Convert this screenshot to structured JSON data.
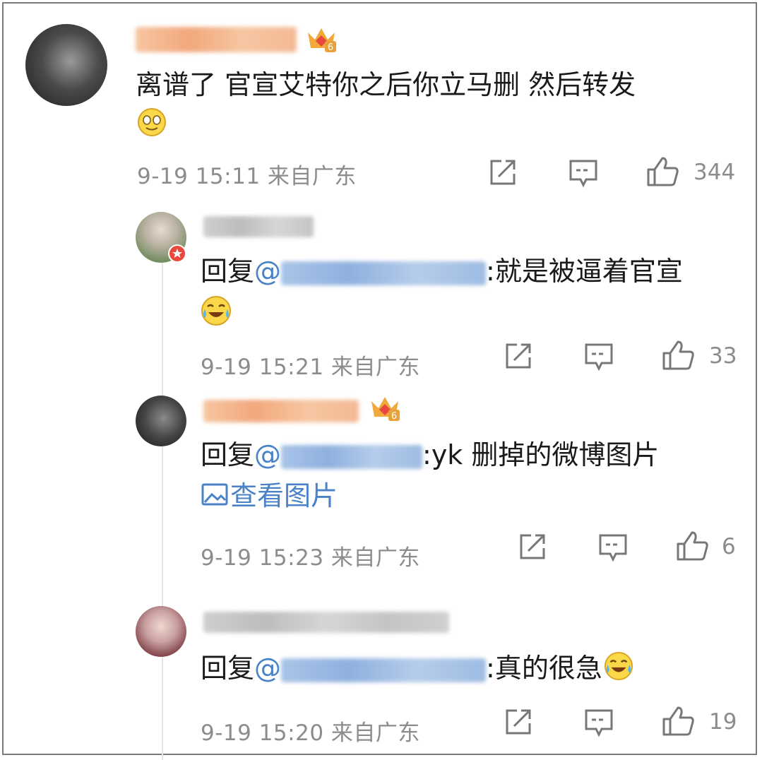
{
  "comments": [
    {
      "text": "离谱了 官宣艾特你之后你立马删 然后转发",
      "time": "9-19 15:11",
      "location": "来自广东",
      "likes": "344",
      "badge_level": "6",
      "emoji_icon": "smile-emoji-icon"
    },
    {
      "reply_prefix": "回复",
      "mention_at": "@",
      "text": ":就是被逼着官宣",
      "time": "9-19 15:21",
      "location": "来自广东",
      "likes": "33",
      "emoji_icon": "laugh-cry-emoji-icon"
    },
    {
      "reply_prefix": "回复",
      "mention_at": "@",
      "text": ":yk 删掉的微博图片",
      "view_image": "查看图片",
      "time": "9-19 15:23",
      "location": "来自广东",
      "likes": "6",
      "badge_level": "6"
    },
    {
      "reply_prefix": "回复",
      "mention_at": "@",
      "text": ":真的很急",
      "time": "9-19 15:20",
      "location": "来自广东",
      "likes": "19",
      "emoji_icon": "laugh-cry-emoji-icon"
    }
  ],
  "colors": {
    "meta": "#8c8c8c",
    "mention": "#4a82c8",
    "username_blur": "#f2b38a"
  }
}
